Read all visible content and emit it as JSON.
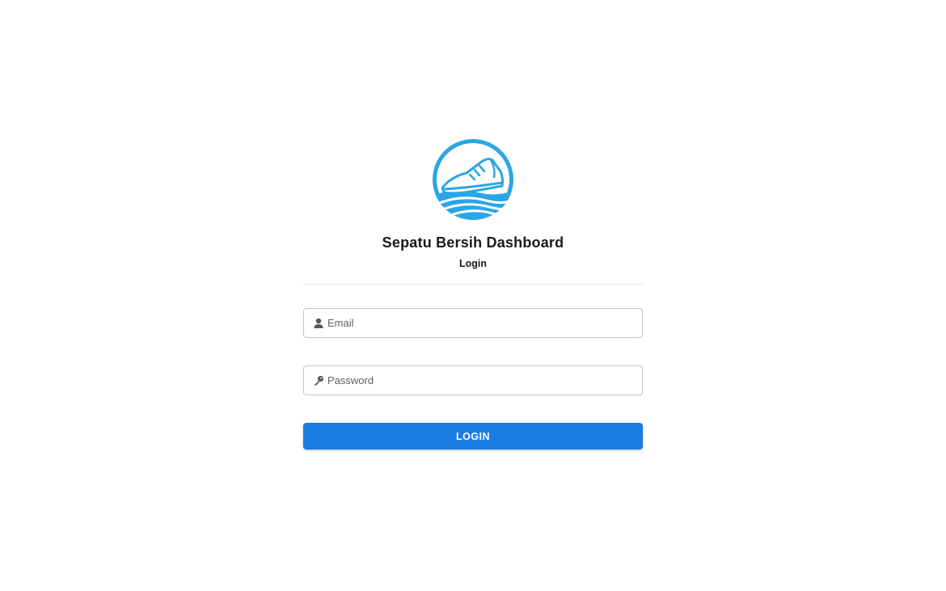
{
  "branding": {
    "logo_icon": "sneaker-wave-logo-icon",
    "app_title": "Sepatu Bersih Dashboard",
    "subtitle": "Login",
    "accent_color": "#2aa6e6"
  },
  "form": {
    "email": {
      "icon": "user-icon",
      "placeholder": "Email",
      "value": ""
    },
    "password": {
      "icon": "key-icon",
      "placeholder": "Password",
      "value": ""
    },
    "submit_label": "LOGIN",
    "submit_color": "#1a7be3"
  }
}
